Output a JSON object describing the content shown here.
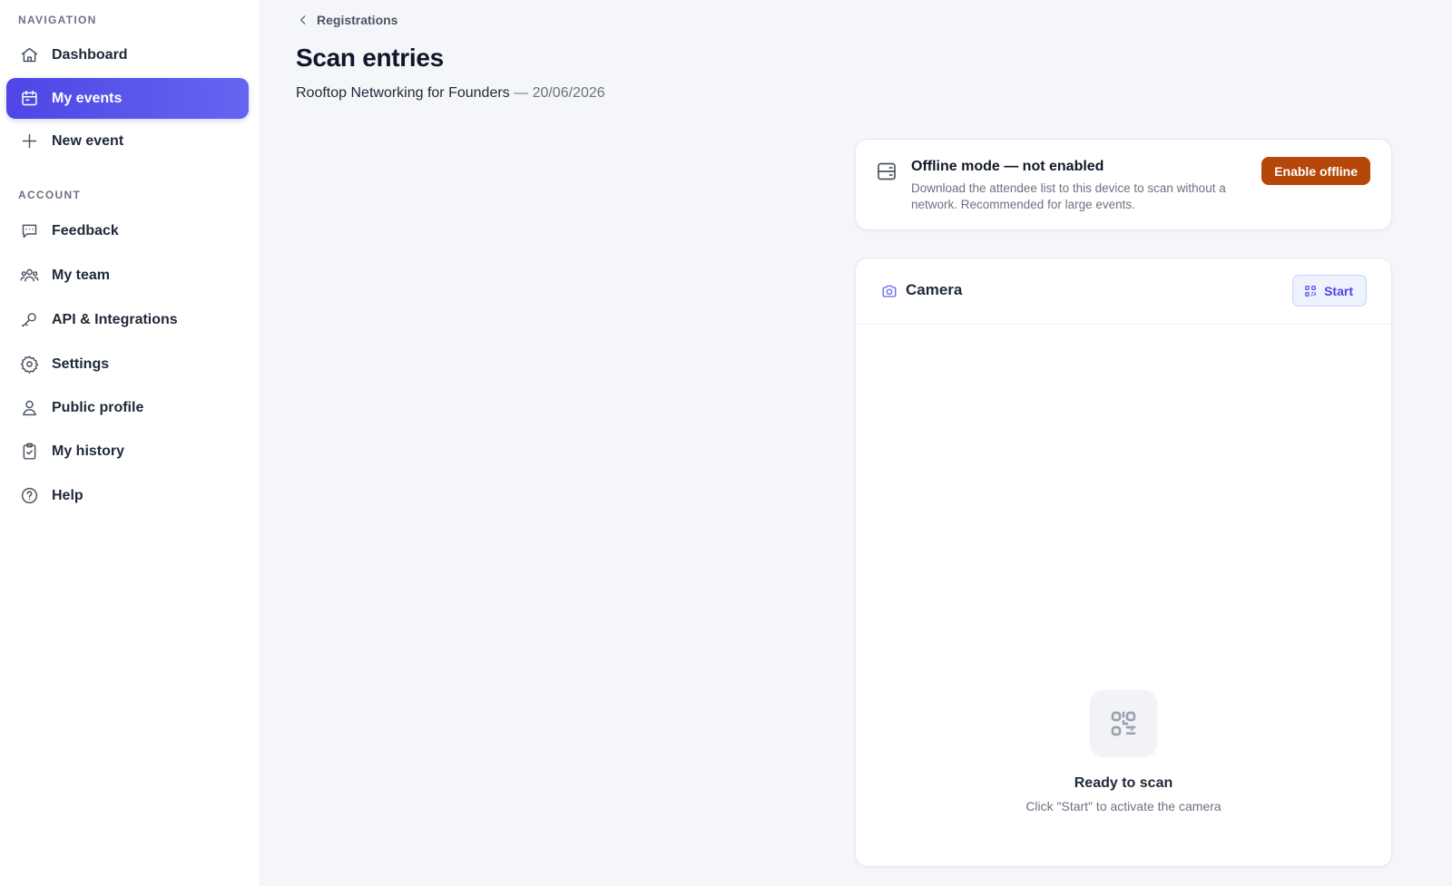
{
  "sidebar": {
    "nav_heading": "NAVIGATION",
    "nav_items": [
      {
        "label": "Dashboard",
        "icon": "home-icon"
      },
      {
        "label": "My events",
        "icon": "calendar-icon",
        "active": true
      },
      {
        "label": "New event",
        "icon": "plus-icon"
      }
    ],
    "account_heading": "ACCOUNT",
    "account_items": [
      {
        "label": "Feedback",
        "icon": "message-icon"
      },
      {
        "label": "My team",
        "icon": "users-icon"
      },
      {
        "label": "API & Integrations",
        "icon": "key-icon"
      },
      {
        "label": "Settings",
        "icon": "gear-icon"
      },
      {
        "label": "Public profile",
        "icon": "user-icon"
      },
      {
        "label": "My history",
        "icon": "clipboard-check-icon"
      },
      {
        "label": "Help",
        "icon": "help-circle-icon"
      }
    ]
  },
  "header": {
    "breadcrumb": "Registrations",
    "title": "Scan entries",
    "event_name": "Rooftop Networking for Founders",
    "separator": " — ",
    "event_date": "20/06/2026"
  },
  "offline": {
    "icon": "server-icon",
    "title": "Offline mode — not enabled",
    "description": "Download the attendee list to this device to scan without a network. Recommended for large events.",
    "button_label": "Enable offline"
  },
  "camera": {
    "icon": "camera-icon",
    "title": "Camera",
    "start_label": "Start",
    "placeholder_icon": "qr-code-icon",
    "ready_title": "Ready to scan",
    "ready_sub": "Click \"Start\" to activate the camera"
  },
  "colors": {
    "accent": "#4f46e5",
    "warning_button": "#b54708",
    "background": "#f4f6fa"
  }
}
